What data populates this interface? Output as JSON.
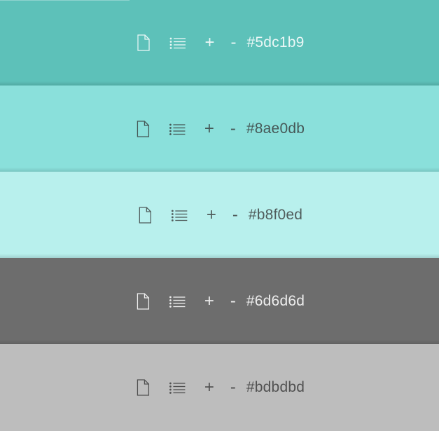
{
  "swatches": [
    {
      "hex": "#5dc1b9",
      "background": "#5dc1b9",
      "foreground": "#ffffff",
      "opacity": 0.88
    },
    {
      "hex": "#8ae0db",
      "background": "#8ae0db",
      "foreground": "#333333",
      "opacity": 0.78
    },
    {
      "hex": "#b8f0ed",
      "background": "#b8f0ed",
      "foreground": "#333333",
      "opacity": 0.78
    },
    {
      "hex": "#6d6d6d",
      "background": "#6d6d6d",
      "foreground": "#ffffff",
      "opacity": 0.88
    },
    {
      "hex": "#bdbdbd",
      "background": "#bdbdbd",
      "foreground": "#333333",
      "opacity": 0.78
    }
  ],
  "controls": {
    "document_icon": "document-icon",
    "list_icon": "list-icon",
    "add_label": "+",
    "remove_label": "-"
  }
}
